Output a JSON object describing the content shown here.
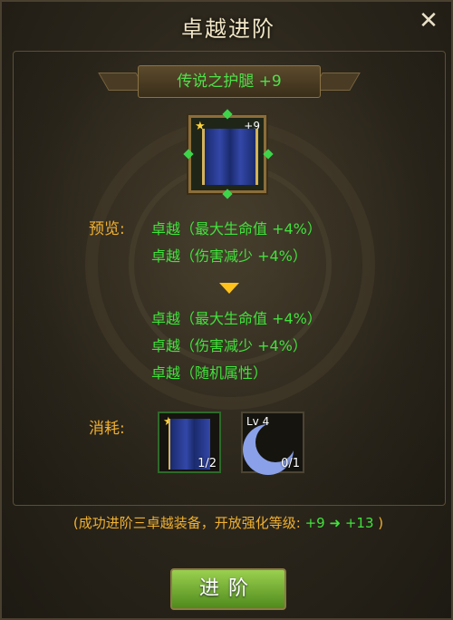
{
  "window": {
    "title": "卓越进阶"
  },
  "item": {
    "name": "传说之护腿 +9",
    "level_badge": "+9",
    "icon": "blue-leggings-icon"
  },
  "preview": {
    "label": "预览:",
    "lines": [
      "卓越（最大生命值 +4%）",
      "卓越（伤害减少 +4%）"
    ]
  },
  "result": {
    "lines": [
      "卓越（最大生命值 +4%）",
      "卓越（伤害减少 +4%）",
      "卓越（随机属性）"
    ]
  },
  "cost": {
    "label": "消耗:",
    "items": [
      {
        "icon": "blue-leggings-icon",
        "count": "1/2"
      },
      {
        "icon": "crescent-moon-icon",
        "level": "Lv 4",
        "count": "0/1"
      }
    ]
  },
  "note": {
    "prefix": "(成功进阶三卓越装备，开放强化等级:",
    "from": "+9",
    "arrow": "➜",
    "to": "+13",
    "suffix": ")"
  },
  "button": {
    "label": "进阶"
  }
}
